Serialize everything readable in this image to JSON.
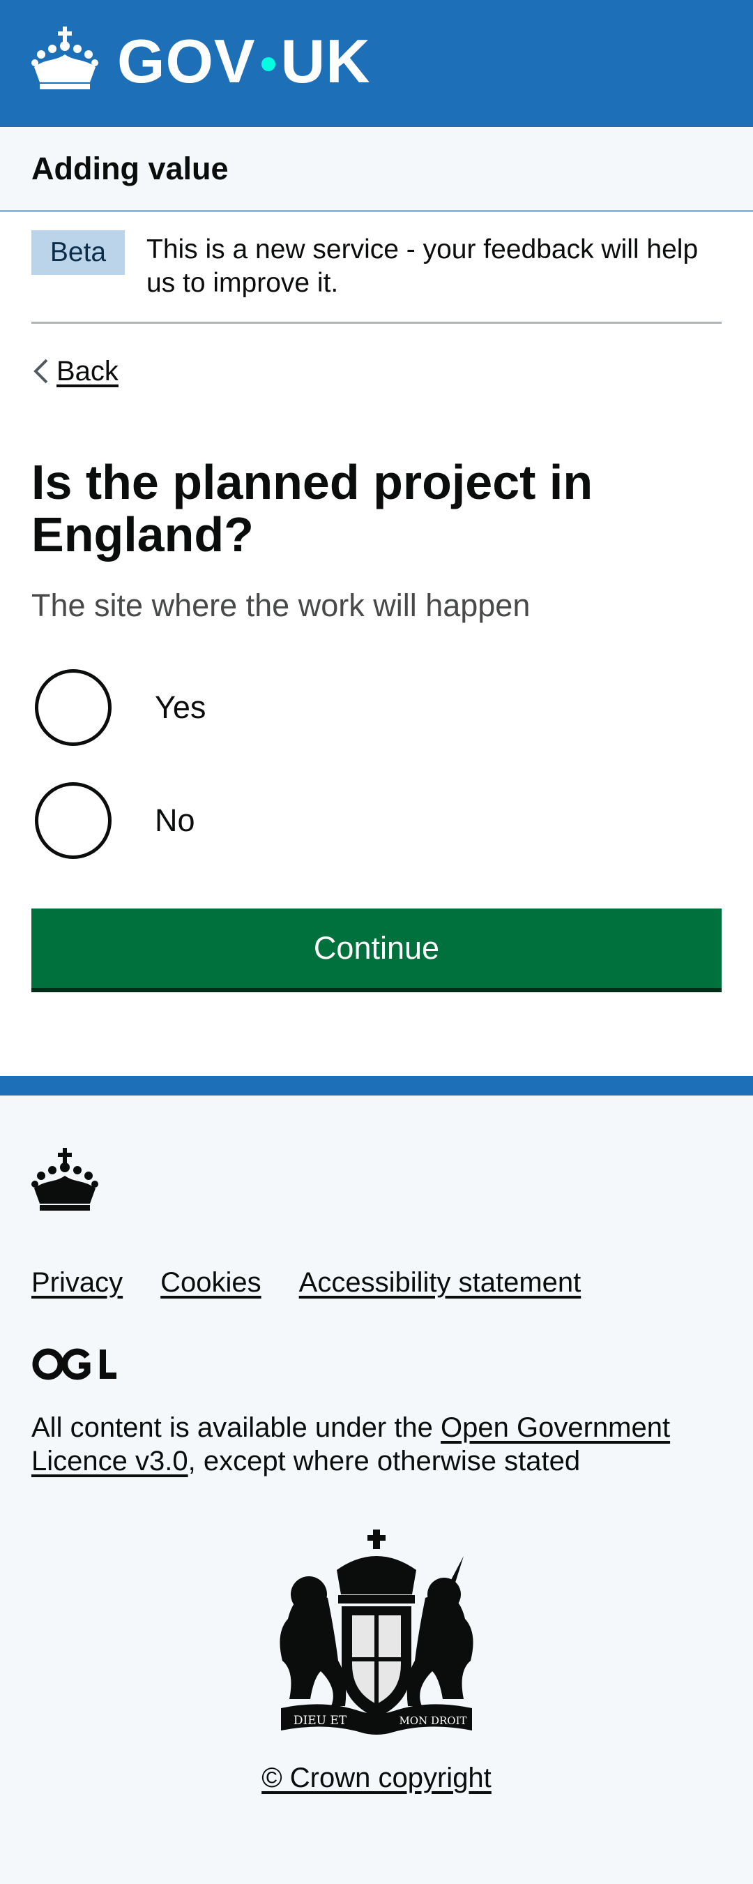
{
  "header": {
    "logotype_left": "GOV",
    "logotype_right": "UK",
    "crown_icon": "crown-icon"
  },
  "service": {
    "name": "Adding value"
  },
  "phase_banner": {
    "tag": "Beta",
    "text": "This is a new service - your feedback will help us to improve it."
  },
  "back_link": {
    "label": "Back"
  },
  "question": {
    "heading": "Is the planned project in England?",
    "hint": "The site where the work will happen",
    "options": [
      {
        "label": "Yes",
        "selected": false
      },
      {
        "label": "No",
        "selected": false
      }
    ]
  },
  "continue_button": {
    "label": "Continue"
  },
  "footer": {
    "links": [
      "Privacy",
      "Cookies",
      "Accessibility statement"
    ],
    "licence_prefix": "All content is available under the ",
    "licence_link": "Open Government Licence v3.0",
    "licence_suffix": ", except where otherwise stated",
    "copyright": "© Crown copyright",
    "ogl_logo_text": "OGL",
    "coat_of_arms_text": [
      "DIEU ET",
      "MON DROIT"
    ]
  },
  "colors": {
    "header_blue": "#1d70b8",
    "button_green": "#00703c",
    "text": "#0b0c0c",
    "footer_bg": "#f4f8fb"
  }
}
